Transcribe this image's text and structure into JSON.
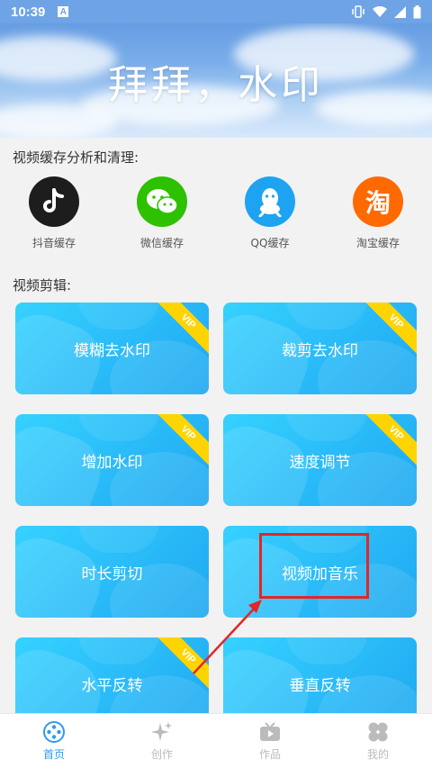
{
  "status_bar": {
    "time": "10:39",
    "a_badge": "A"
  },
  "banner": {
    "title": "拜拜，水印"
  },
  "cache_section": {
    "title": "视频缓存分析和清理:",
    "apps": [
      {
        "label": "抖音缓存",
        "icon": "tiktok-icon"
      },
      {
        "label": "微信缓存",
        "icon": "wechat-icon"
      },
      {
        "label": "QQ缓存",
        "icon": "qq-icon"
      },
      {
        "label": "淘宝缓存",
        "icon": "taobao-icon",
        "glyph": "淘"
      }
    ]
  },
  "edit_section": {
    "title": "视频剪辑:",
    "vip_text": "VIP",
    "tools": [
      {
        "label": "模糊去水印",
        "vip": true
      },
      {
        "label": "裁剪去水印",
        "vip": true
      },
      {
        "label": "增加水印",
        "vip": true
      },
      {
        "label": "速度调节",
        "vip": true
      },
      {
        "label": "时长剪切",
        "vip": false
      },
      {
        "label": "视频加音乐",
        "vip": false
      },
      {
        "label": "水平反转",
        "vip": true
      },
      {
        "label": "垂直反转",
        "vip": false
      }
    ]
  },
  "bottom_nav": [
    {
      "label": "首页",
      "active": true
    },
    {
      "label": "创作",
      "active": false
    },
    {
      "label": "作品",
      "active": false
    },
    {
      "label": "我的",
      "active": false
    }
  ],
  "colors": {
    "accent": "#2c9bf0",
    "card": "#28b8f7",
    "vip": "#ffd400",
    "annotation": "#e32626"
  }
}
